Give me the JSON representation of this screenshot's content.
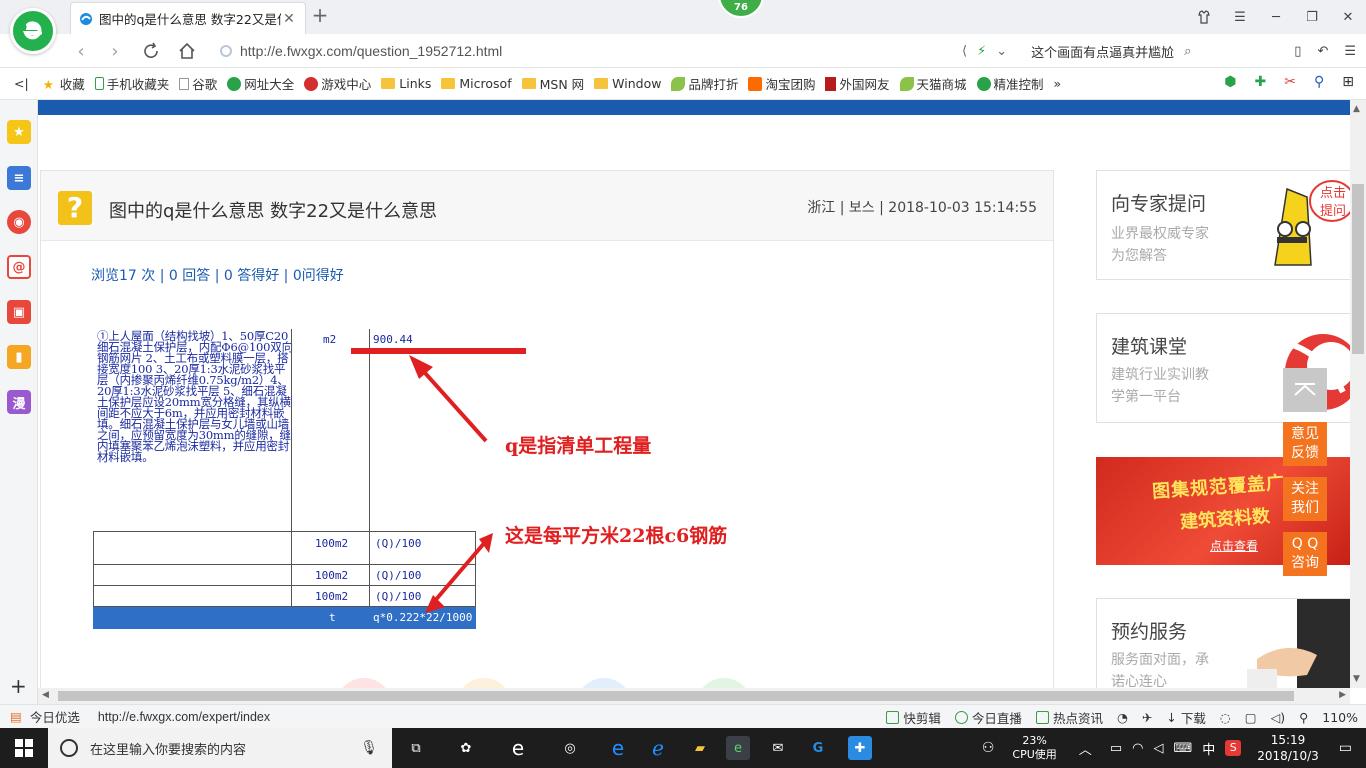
{
  "browser": {
    "tab_title": "图中的q是什么意思 数字22又是什么意思",
    "badge": "76",
    "url": "http://e.fwxgx.com/question_1952712.html",
    "hot_search": "这个画面有点逼真并尴尬"
  },
  "bookmarks": [
    {
      "label": "收藏",
      "icon": "star-icon"
    },
    {
      "label": "手机收藏夹",
      "icon": "phone-icon"
    },
    {
      "label": "谷歌",
      "icon": "page-icon"
    },
    {
      "label": "网址大全",
      "icon": "globe-icon"
    },
    {
      "label": "游戏中心",
      "icon": "game-icon"
    },
    {
      "label": "Links",
      "icon": "folder-icon"
    },
    {
      "label": "Microsof",
      "icon": "folder-icon"
    },
    {
      "label": "MSN 网",
      "icon": "folder-icon"
    },
    {
      "label": "Window",
      "icon": "folder-icon"
    },
    {
      "label": "品牌打折",
      "icon": "leaf-icon"
    },
    {
      "label": "淘宝团购",
      "icon": "taobao-icon"
    },
    {
      "label": "外国网友",
      "icon": "bookmark-icon"
    },
    {
      "label": "天猫商城",
      "icon": "leaf-icon"
    },
    {
      "label": "精准控制",
      "icon": "wechat-icon"
    }
  ],
  "bookmarks_more": "»",
  "question": {
    "title": "图中的q是什么意思 数字22又是什么意思",
    "meta": "浙江 | 보스 | 2018-10-03 15:14:55",
    "stats": "浏览17 次 | 0 回答 | 0 答得好 | 0问得好"
  },
  "scan": {
    "spec_text": "①上人屋面（结构找坡）1、50厚C20细石混凝土保护层，内配Φ6@100双向钢筋网片 2、土工布或塑料膜一层，搭接宽度100 3、20厚1:3水泥砂浆找平层（内掺聚丙烯纤维0.75kg/m2）4、20厚1:3水泥砂浆找平层 5、细石混凝土保护层应设20mm宽分格缝，其纵横间距不应大于6m，并应用密封材料嵌填。细石混凝土保护层与女儿墙或山墙之间，应预留宽度为30mm的缝隙，缝内填塞聚苯乙烯泡沫塑料，并应用密封材料嵌填。",
    "row0_unit": "m2",
    "row0_qty": "900.44",
    "rows": [
      {
        "unit": "100m2",
        "qty": "(Q)/100"
      },
      {
        "unit": "100m2",
        "qty": "(Q)/100"
      },
      {
        "unit": "100m2",
        "qty": "(Q)/100"
      }
    ],
    "sel_unit": "t",
    "sel_qty": "q*0.222*22/1000"
  },
  "annotations": {
    "note1": "q是指清单工程量",
    "note2": "这是每平方米22根c6钢筋"
  },
  "right_cards": {
    "expert_title": "向专家提问",
    "expert_sub1": "业界最权威专家",
    "expert_sub2": "为您解答",
    "expert_bubble": "点击提问",
    "class_title": "建筑课堂",
    "class_sub1": "建筑行业实训教",
    "class_sub2": "学第一平台",
    "banner_line1": "图集规范覆盖广",
    "banner_line2": "建筑资料数",
    "banner_btn": "点击查看",
    "service_title": "预约服务",
    "service_sub1": "服务面对面，承",
    "service_sub2": "诺心连心"
  },
  "float_buttons": [
    {
      "line1": "意见",
      "line2": "反馈"
    },
    {
      "line1": "关注",
      "line2": "我们"
    },
    {
      "line1": "Q Q",
      "line2": "咨询"
    }
  ],
  "statusbar": {
    "left_label": "今日优选",
    "link": "http://e.fwxgx.com/expert/index",
    "items": [
      "快剪辑",
      "今日直播",
      "热点资讯",
      "下载"
    ],
    "zoom": "110%"
  },
  "taskbar": {
    "search_placeholder": "在这里输入你要搜索的内容",
    "cpu_percent": "23%",
    "cpu_label": "CPU使用",
    "ime": "中",
    "time": "15:19",
    "date": "2018/10/3"
  },
  "colors": {
    "accent_blue": "#1a5bb0",
    "annotation_red": "#e02020",
    "float_orange": "#f3731f",
    "question_yellow": "#f2c21b"
  }
}
